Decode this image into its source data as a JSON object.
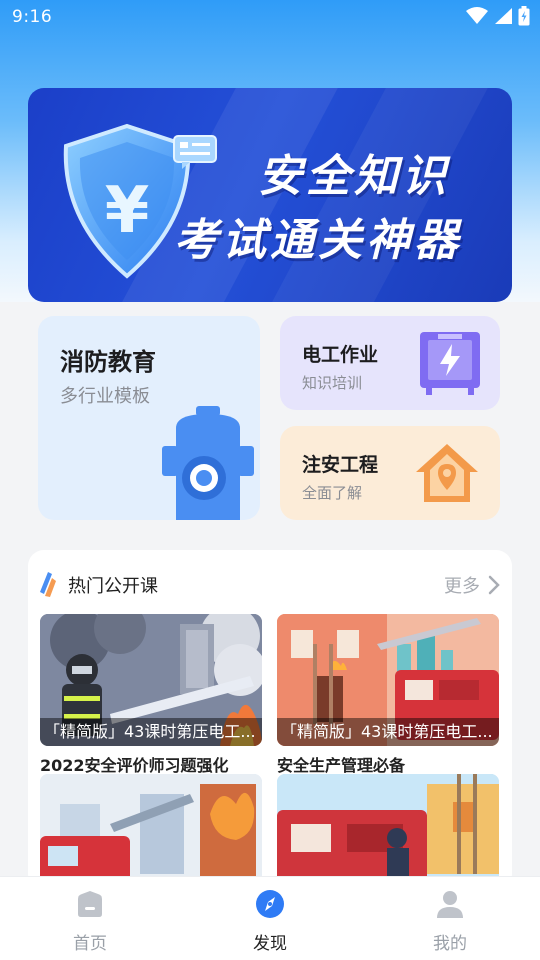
{
  "status_bar": {
    "time": "9:16"
  },
  "banner": {
    "line1": "安全知识",
    "line2": "考试通关神器"
  },
  "categories": [
    {
      "title": "消防教育",
      "subtitle": "多行业模板"
    },
    {
      "title": "电工作业",
      "subtitle": "知识培训"
    },
    {
      "title": "注安工程",
      "subtitle": "全面了解"
    }
  ],
  "hot_courses": {
    "title": "热门公开课",
    "more_label": "更多",
    "items": [
      {
        "caption": "「精简版」43课时第压电工...",
        "name": "2022安全评价师习题强化"
      },
      {
        "caption": "「精简版」43课时第压电工...",
        "name": "安全生产管理必备"
      },
      {
        "caption": "",
        "name": ""
      },
      {
        "caption": "",
        "name": ""
      }
    ]
  },
  "tab_bar": {
    "tabs": [
      {
        "label": "首页",
        "icon": "home-icon",
        "active": false
      },
      {
        "label": "发现",
        "icon": "compass-icon",
        "active": true
      },
      {
        "label": "我的",
        "icon": "user-icon",
        "active": false
      }
    ]
  },
  "colors": {
    "accent": "#2f7bf5",
    "banner": "#1f46cc",
    "text_primary": "#222222",
    "text_muted": "#9aa0a8"
  }
}
